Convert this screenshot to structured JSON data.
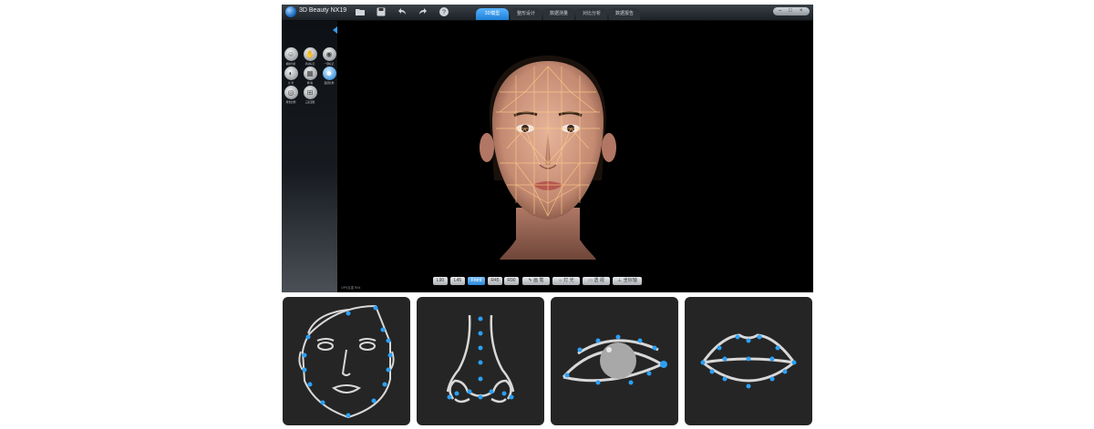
{
  "app": {
    "title": "3D Beauty NX19",
    "toolbar_icons": [
      "folder-icon",
      "save-icon",
      "undo-icon",
      "redo-icon",
      "help-icon"
    ],
    "window_controls": [
      "minimize-icon",
      "maximize-icon",
      "close-icon"
    ]
  },
  "tabs": [
    {
      "label": "3D模型",
      "active": true
    },
    {
      "label": "整形设计",
      "active": false
    },
    {
      "label": "数据测量",
      "active": false
    },
    {
      "label": "对比分析",
      "active": false
    },
    {
      "label": "数据报告",
      "active": false
    }
  ],
  "sidebar": {
    "tools": [
      {
        "label": "模拟分析",
        "icon": "face-analysis-icon",
        "selected": false
      },
      {
        "label": "手动标记",
        "icon": "manual-mark-icon",
        "selected": false
      },
      {
        "label": "一键标记",
        "icon": "auto-mark-icon",
        "selected": false
      },
      {
        "label": "全 景",
        "icon": "panorama-icon",
        "selected": false
      },
      {
        "label": "网 格",
        "icon": "grid-icon",
        "selected": false
      },
      {
        "label": "面部比例",
        "icon": "face-ratio-icon",
        "selected": true
      },
      {
        "label": "黄金比例",
        "icon": "golden-ratio-icon",
        "selected": false
      },
      {
        "label": "三庭五眼",
        "icon": "three-five-icon",
        "selected": false
      }
    ]
  },
  "view_buttons": [
    {
      "label": "L90",
      "active": false
    },
    {
      "label": "L45",
      "active": false
    },
    {
      "label": "Front",
      "active": true
    },
    {
      "label": "R45",
      "active": false
    },
    {
      "label": "R90",
      "active": false
    },
    {
      "label": "画 笔",
      "icon": "brush-icon",
      "active": false
    },
    {
      "label": "灯 光",
      "icon": "light-icon",
      "active": false
    },
    {
      "label": "透 视",
      "icon": "perspective-icon",
      "active": false
    },
    {
      "label": "坐标轴",
      "icon": "axis-icon",
      "active": false
    }
  ],
  "status": {
    "text": "OPh互重 RII4"
  },
  "accent_color": "#2f93e5",
  "marker_color": "#2aa0f5",
  "panels": [
    {
      "name": "face-landmarks-panel",
      "icon": "face-diagram-icon"
    },
    {
      "name": "nose-landmarks-panel",
      "icon": "nose-diagram-icon"
    },
    {
      "name": "eye-landmarks-panel",
      "icon": "eye-diagram-icon"
    },
    {
      "name": "lips-landmarks-panel",
      "icon": "lips-diagram-icon"
    }
  ]
}
